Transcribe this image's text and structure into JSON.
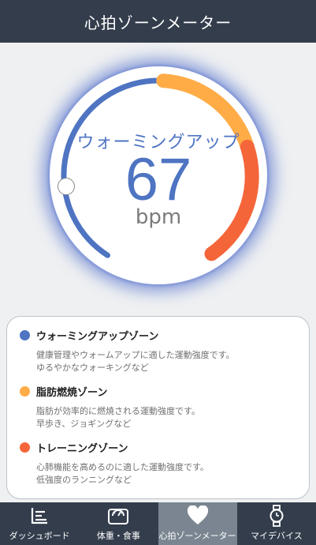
{
  "header": {
    "title": "心拍ゾーンメーター"
  },
  "gauge": {
    "zone_label": "ウォーミングアップ",
    "bpm": "67",
    "unit": "bpm",
    "colors": {
      "warmup": "#4e74c2",
      "fatburn": "#ffac47",
      "training": "#f5653a",
      "glow": "#4664c8"
    }
  },
  "legend": {
    "items": [
      {
        "title": "ウォーミングアップゾーン",
        "color": "#4e74c2",
        "line1": "健康管理やウォームアップに適した運動強度です。",
        "line2": "ゆるやかなウォーキングなど"
      },
      {
        "title": "脂肪燃焼ゾーン",
        "color": "#ffac47",
        "line1": "脂肪が効率的に燃焼される運動強度です。",
        "line2": "早歩き、ジョギングなど"
      },
      {
        "title": "トレーニングゾーン",
        "color": "#f5653a",
        "line1": "心肺機能を高めるのに適した運動強度です。",
        "line2": "低強度のランニングなど"
      }
    ]
  },
  "nav": {
    "tabs": [
      {
        "label": "ダッシュボード",
        "icon": "dashboard-chart-icon"
      },
      {
        "label": "体重・食事",
        "icon": "scale-icon"
      },
      {
        "label": "心拍ゾーンメーター",
        "icon": "heart-icon"
      },
      {
        "label": "マイデバイス",
        "icon": "watch-icon"
      }
    ],
    "active_index": 2
  }
}
